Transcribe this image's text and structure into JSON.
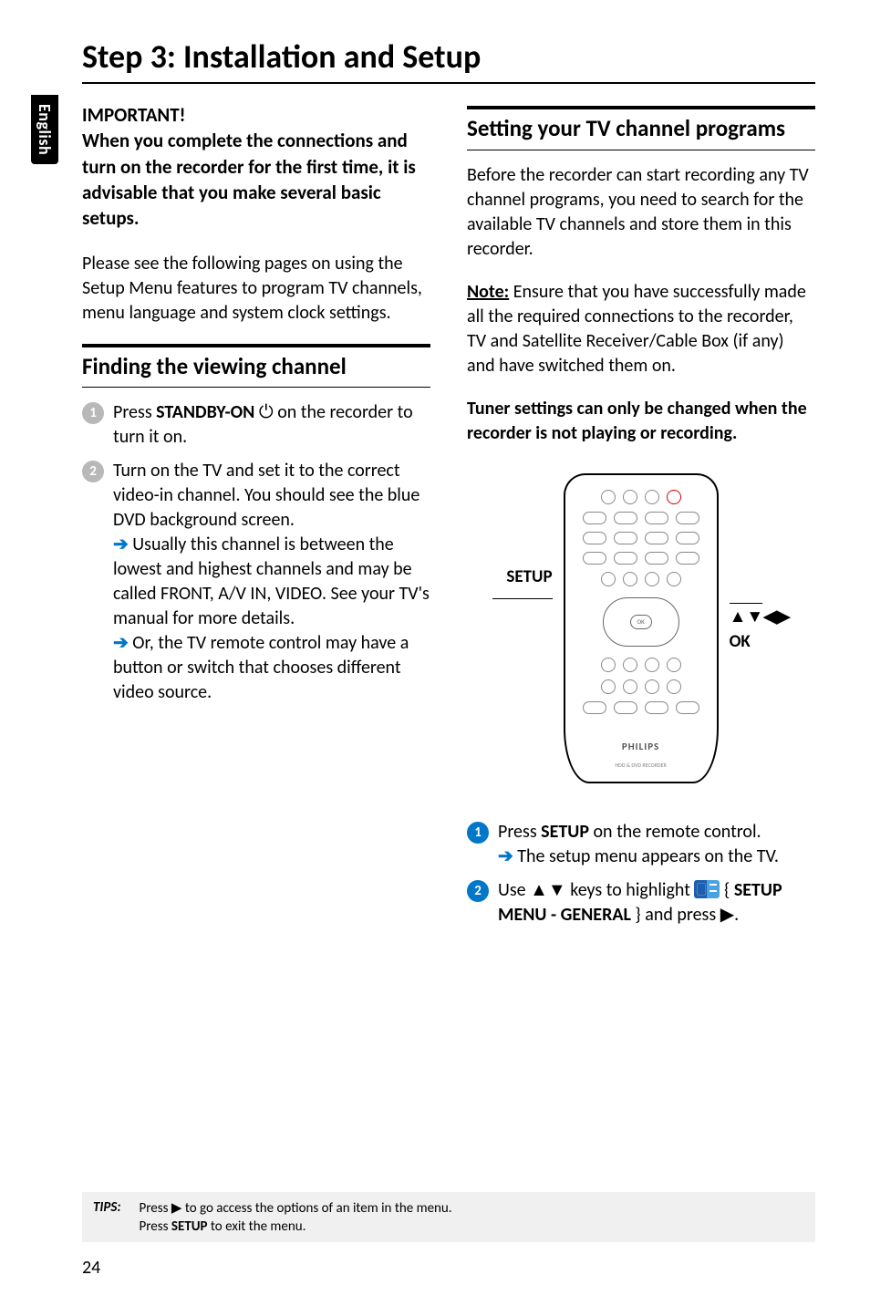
{
  "lang_tab": "English",
  "title": "Step 3: Installation and Setup",
  "left": {
    "important_head": "IMPORTANT!",
    "important_body": "When you complete the connections and turn on the recorder for the first time, it is advisable that you make several basic setups.",
    "intro_para": "Please see the following pages on using the Setup Menu features to program TV channels, menu language and system clock settings.",
    "sec_finding": "Finding the viewing channel",
    "step1_pre": "Press ",
    "step1_cmd": "STANDBY-ON",
    "step1_icon": " ⏻ ",
    "step1_post": "on the recorder to turn it on.",
    "step2_pre": "Turn on the TV and set it to the correct video-in channel. You should see the blue DVD background screen.",
    "step2_arrow1": "Usually this channel is between the lowest and highest channels and may be called FRONT, A/V IN, VIDEO. See your TV's manual for more details.",
    "step2_arrow2": "Or, the TV remote control may have a button or switch that chooses different video source."
  },
  "right": {
    "sec_setting": "Setting your TV channel programs",
    "para1": "Before the recorder can start recording any TV channel programs, you need to search for the available TV channels and store them in this recorder.",
    "note_label": "Note:",
    "note_body": " Ensure that you have successfully made all the required connections to the recorder, TV and Satellite Receiver/Cable Box (if any) and have switched them on.",
    "tuner_bold": "Tuner settings can only be changed when the recorder is not playing or recording.",
    "label_setup": "SETUP",
    "dirs_arrows": "▲▼◀▶",
    "dirs_ok": "OK",
    "brand": "PHILIPS",
    "sub_brand": "HDD & DVD RECORDER",
    "ok_btn": "OK",
    "step1_pre": "Press ",
    "step1_cmd": "SETUP",
    "step1_post": " on the remote control.",
    "step1_arrow": "The setup menu appears on the TV.",
    "step2_pre": "Use ",
    "step2_keys": "▲▼",
    "step2_mid": " keys to highlight ",
    "step2_menu_pre": "{ ",
    "step2_menu": "SETUP MENU - GENERAL",
    "step2_menu_post": " } and press ",
    "step2_arrow": "▶",
    "step2_dot": "."
  },
  "tips": {
    "label": "TIPS:",
    "line1_pre": "Press ",
    "line1_arrow": "▶",
    "line1_post": " to go access the options of an item in the menu.",
    "line2_pre": "Press ",
    "line2_cmd": "SETUP",
    "line2_post": " to exit the menu."
  },
  "page_num": "24"
}
